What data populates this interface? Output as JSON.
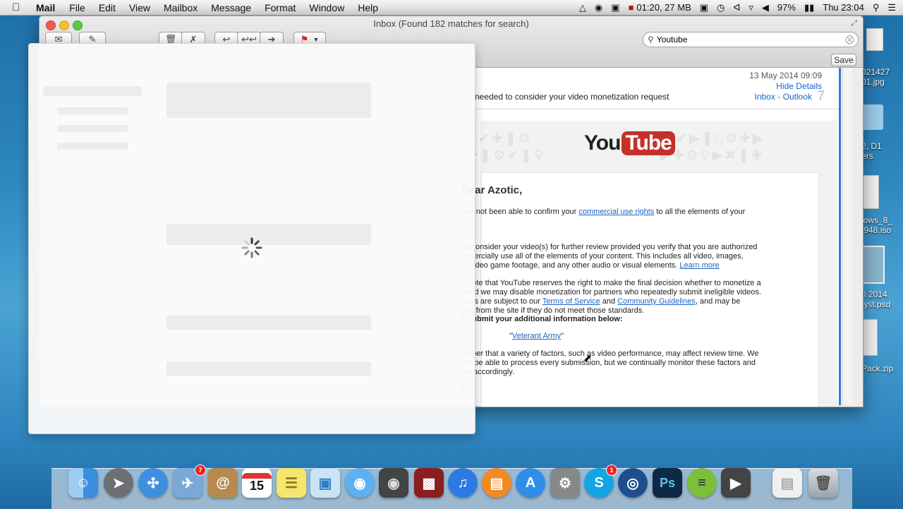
{
  "menubar": {
    "app_name": "Mail",
    "items": [
      "File",
      "Edit",
      "View",
      "Mailbox",
      "Message",
      "Format",
      "Window",
      "Help"
    ],
    "status": {
      "recording": "01:20, 27 MB",
      "battery": "97%",
      "clock": "Thu 23:04"
    }
  },
  "window": {
    "title": "Inbox (Found 182 matches for search)",
    "search_value": "Youtube",
    "save_label": "Save"
  },
  "message": {
    "date": "13 May 2014 09:09",
    "hide_details": "Hide Details",
    "mailbox": "Inbox - Outlook",
    "subject_fragment": "needed to consider your video monetization request",
    "logo_text_you": "You",
    "logo_text_tube": "Tube",
    "greeting": "Dear Azotic,",
    "p1a": "ave not been able to confirm your ",
    "p1_link": "commercial use rights",
    "p1b": " to all the elements of your",
    "p2": "ay consider your video(s) for further review provided you verify that you are authorized\nmmercially use all of the elements of your content. This includes all video, images,\nc, video game footage, and any other audio or visual elements. ",
    "p2_link": "Learn more",
    "p3a": "e note that YouTube reserves the right to make the final decision whether to monetize a\n, and we may disable monetization for partners who repeatedly submit ineligible videos.\ndeos are subject to our ",
    "p3_link1": "Terms of Service",
    "p3_and": " and ",
    "p3_link2": "Community Guidelines",
    "p3b": ", and may be\nved from the site if they do not meet those standards.",
    "p4": "e submit your additional information below:",
    "veterant_q1": "\"",
    "veterant_link": "Veterant Army",
    "veterant_q2": "\"",
    "p5": "ember that a variety of factors, such as video performance, may affect review time. We\nnot be able to process every submission, but we continually monitor these factors and\nize accordingly.",
    "p6": "ks,"
  },
  "desktop_icons": [
    "021427\n01.jpg",
    "2, D1\ners",
    "lows_8_\n.948.iso",
    "/I 2014\n.yst.psd",
    "Pack.zip"
  ],
  "dock": {
    "calendar_day": "15",
    "mail_badge": "7",
    "skype_badge": "1",
    "ps_label": "Ps"
  }
}
